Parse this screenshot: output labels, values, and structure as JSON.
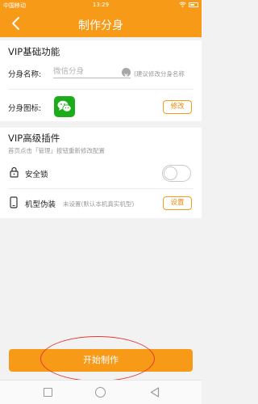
{
  "status": {
    "carrier": "中国移动",
    "time": "13:29"
  },
  "header": {
    "title": "制作分身"
  },
  "basic": {
    "section_title": "VIP基础功能",
    "name_label": "分身名称:",
    "name_placeholder": "微信分身",
    "name_hint": "(建议修改分身名称",
    "icon_label": "分身图标:",
    "modify_label": "修改"
  },
  "advanced": {
    "section_title": "VIP高级插件",
    "hint": "首页点击「管理」按钮重新修改配置",
    "lock_label": "安全锁",
    "lock_enabled": false,
    "device_label": "机型伪装",
    "device_value": "未设置(默认本机真实机型)",
    "device_button": "设置"
  },
  "actions": {
    "start_label": "开始制作"
  },
  "colors": {
    "accent": "#f79a18",
    "annotation": "#e53935"
  }
}
